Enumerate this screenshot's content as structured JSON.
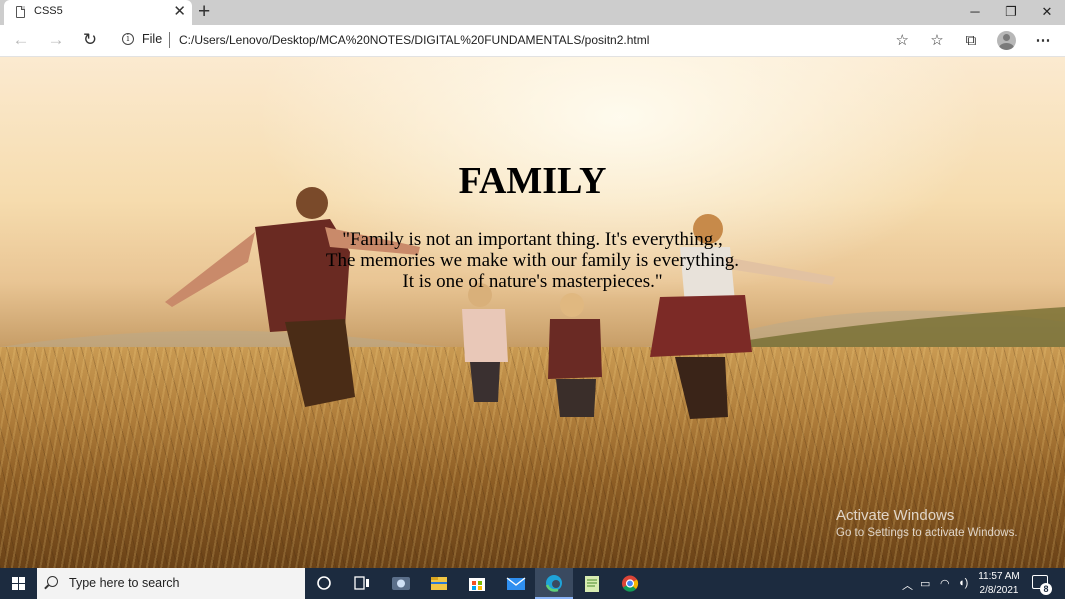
{
  "browser": {
    "tab_title": "CSS5",
    "new_tab_symbol": "+",
    "address_prefix": "File",
    "url": "C:/Users/Lenovo/Desktop/MCA%20NOTES/DIGITAL%20FUNDAMENTALS/positn2.html"
  },
  "page": {
    "heading": "FAMILY",
    "quote_lines": [
      "\"Family is not an important thing. It's everything.,",
      "The memories we make with our family is everything.",
      "It is one of nature's masterpieces.\""
    ],
    "background": "family running through golden wheat field at sunset"
  },
  "watermark": {
    "title": "Activate Windows",
    "subtitle": "Go to Settings to activate Windows."
  },
  "taskbar": {
    "search_placeholder": "Type here to search",
    "time": "11:57 AM",
    "date": "2/8/2021",
    "notification_count": "8",
    "pinned_apps": [
      "cortana-icon",
      "task-view-icon",
      "camera-icon",
      "file-explorer-icon",
      "store-icon",
      "mail-icon",
      "edge-icon",
      "notepad-icon",
      "chrome-icon"
    ]
  },
  "colors": {
    "taskbar": "#1c2b3f",
    "tabstrip": "#cdcdcd"
  }
}
